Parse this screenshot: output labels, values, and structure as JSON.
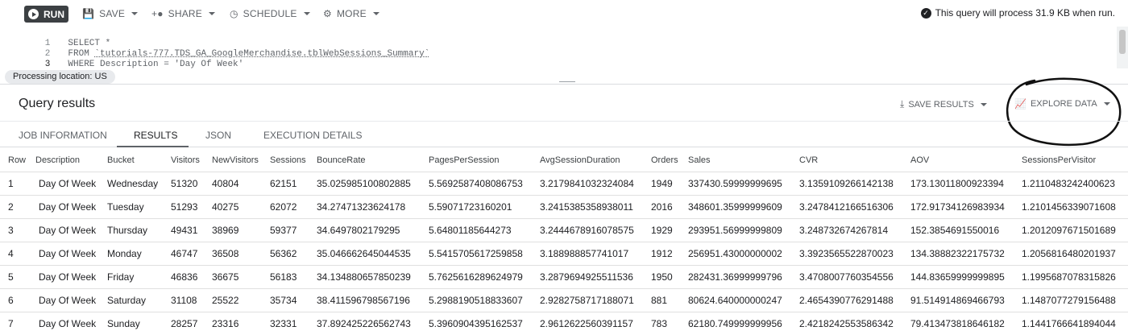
{
  "toolbar": {
    "run_label": "RUN",
    "save_label": "SAVE",
    "share_label": "SHARE",
    "schedule_label": "SCHEDULE",
    "more_label": "MORE",
    "process_note": "This query will process 31.9 KB when run."
  },
  "editor": {
    "lines": [
      {
        "num": "1",
        "code": "SELECT *"
      },
      {
        "num": "2",
        "code_prefix": "FROM ",
        "table": "`tutorials-777.TDS_GA_GoogleMerchandise.tblWebSessions_Summary`"
      },
      {
        "num": "3",
        "code": "WHERE Description = 'Day Of Week'"
      }
    ]
  },
  "location_chip": "Processing location: US",
  "results": {
    "title": "Query results",
    "save_results_label": "SAVE RESULTS",
    "explore_data_label": "EXPLORE DATA"
  },
  "tabs": [
    "JOB INFORMATION",
    "RESULTS",
    "JSON",
    "EXECUTION DETAILS"
  ],
  "table": {
    "columns": [
      "Row",
      "Description",
      "Bucket",
      "Visitors",
      "NewVisitors",
      "Sessions",
      "BounceRate",
      "PagesPerSession",
      "AvgSessionDuration",
      "Orders",
      "Sales",
      "CVR",
      "AOV",
      "SessionsPerVisitor"
    ],
    "rows": [
      [
        "1",
        "Day Of Week",
        "Wednesday",
        "51320",
        "40804",
        "62151",
        "35.025985100802885",
        "5.5692587408086753",
        "3.2179841032324084",
        "1949",
        "337430.59999999695",
        "3.1359109266142138",
        "173.13011800923394",
        "1.2110483242400623"
      ],
      [
        "2",
        "Day Of Week",
        "Tuesday",
        "51293",
        "40275",
        "62072",
        "34.27471323624178",
        "5.59071723160201",
        "3.2415385358938011",
        "2016",
        "348601.35999999609",
        "3.2478412166516306",
        "172.91734126983934",
        "1.2101456339071608"
      ],
      [
        "3",
        "Day Of Week",
        "Thursday",
        "49431",
        "38969",
        "59377",
        "34.6497802179295",
        "5.64801185644273",
        "3.2444678916078575",
        "1929",
        "293951.56999999809",
        "3.248732674267814",
        "152.3854691550016",
        "1.2012097671501689"
      ],
      [
        "4",
        "Day Of Week",
        "Monday",
        "46747",
        "36508",
        "56362",
        "35.046662645044535",
        "5.5415705617259858",
        "3.188988857741017",
        "1912",
        "256951.43000000002",
        "3.3923565522870023",
        "134.38882322175732",
        "1.2056816480201937"
      ],
      [
        "5",
        "Day Of Week",
        "Friday",
        "46836",
        "36675",
        "56183",
        "34.134880657850239",
        "5.7625616289624979",
        "3.2879694925511536",
        "1950",
        "282431.36999999796",
        "3.4708007760354556",
        "144.83659999999895",
        "1.1995687078315826"
      ],
      [
        "6",
        "Day Of Week",
        "Saturday",
        "31108",
        "25522",
        "35734",
        "38.411596798567196",
        "5.2988190518833607",
        "2.9282758717188071",
        "881",
        "80624.640000000247",
        "2.4654390776291488",
        "91.514914869466793",
        "1.1487077279156488"
      ],
      [
        "7",
        "Day Of Week",
        "Sunday",
        "28257",
        "23316",
        "32331",
        "37.892425226562743",
        "5.3960904395162537",
        "2.9612622560391157",
        "783",
        "62180.749999999956",
        "2.4218242553586342",
        "79.413473818646182",
        "1.1441766641894044"
      ]
    ]
  }
}
